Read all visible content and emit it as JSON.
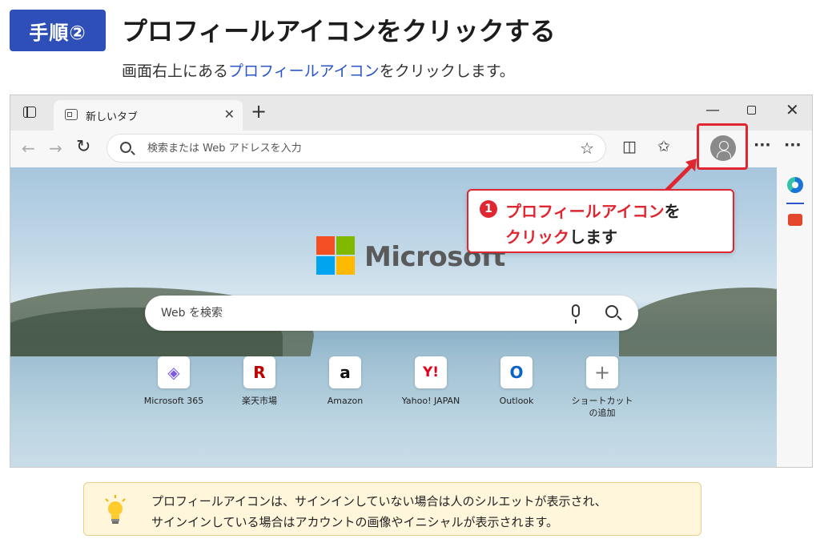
{
  "header": {
    "step_badge": "手順②",
    "title": "プロフィールアイコンをクリックする",
    "subtitle_before": "画面右上にある",
    "subtitle_highlight": "プロフィールアイコン",
    "subtitle_after": "をクリックします。"
  },
  "browser": {
    "tab_title": "新しいタブ",
    "tab_close": "✕",
    "new_tab": "+",
    "window_minimize": "—",
    "window_close": "✕",
    "nav_back": "←",
    "nav_forward": "→",
    "nav_reload": "↻",
    "address_placeholder": "検索または Web アドレスを入力",
    "favorite_star": "☆",
    "toolbar_split": "◫",
    "toolbar_favorites": "✩",
    "toolbar_more": "···",
    "toolbar_menu": "···"
  },
  "newtab": {
    "brand": "Microsoft",
    "search_placeholder": "Web を検索",
    "quick_links": [
      {
        "label": "Microsoft 365",
        "glyph": "◈",
        "color": "#7b5be0"
      },
      {
        "label": "楽天市場",
        "glyph": "R",
        "color": "#bf0000"
      },
      {
        "label": "Amazon",
        "glyph": "a",
        "color": "#111111"
      },
      {
        "label": "Yahoo! JAPAN",
        "glyph": "Y!",
        "color": "#e0001b"
      },
      {
        "label": "Outlook",
        "glyph": "O",
        "color": "#0a64c8"
      },
      {
        "label": "ショートカット\nの追加",
        "glyph": "+",
        "color": "#777777"
      }
    ]
  },
  "callout": {
    "number": "1",
    "line1_red": "プロフィールアイコン",
    "line1_after": "を",
    "line2_red": "クリック",
    "line2_after": "します"
  },
  "note": {
    "line1": "プロフィールアイコンは、サインインしていない場合は人のシルエットが表示され、",
    "line2": "サインインしている場合はアカウントの画像やイニシャルが表示されます。"
  },
  "colors": {
    "accent_blue": "#2e4fb8",
    "highlight_red": "#e02631",
    "note_bg": "#fff6dc"
  }
}
